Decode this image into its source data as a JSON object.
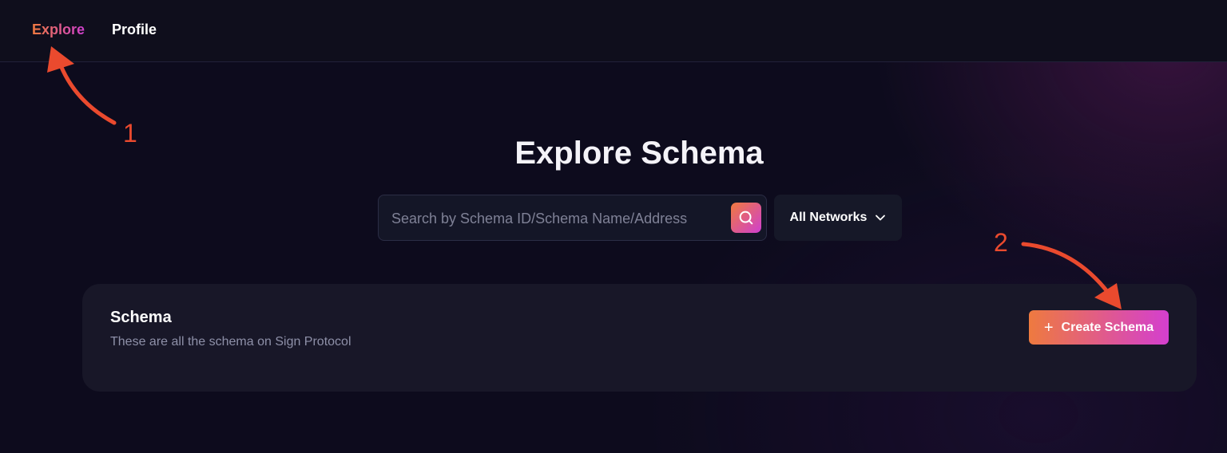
{
  "nav": {
    "explore_label": "Explore",
    "profile_label": "Profile"
  },
  "main": {
    "title": "Explore Schema",
    "search": {
      "placeholder": "Search by Schema ID/Schema Name/Address",
      "value": "",
      "button_icon": "search-icon"
    },
    "network_filter": {
      "selected": "All Networks",
      "icon": "chevron-down-icon"
    }
  },
  "schema_card": {
    "title": "Schema",
    "subtitle": "These are all the schema on Sign Protocol",
    "create_button": {
      "icon": "+",
      "label": "Create Schema"
    }
  },
  "annotations": [
    {
      "label": "1"
    },
    {
      "label": "2"
    }
  ],
  "colors": {
    "background": "#0d0b1d",
    "topbar": "#0f0e1c",
    "card": "#181728",
    "accent_start": "#f07a3e",
    "accent_end": "#cf3fd0",
    "annotation": "#ea4a2e",
    "muted_text": "#8e90a8"
  }
}
